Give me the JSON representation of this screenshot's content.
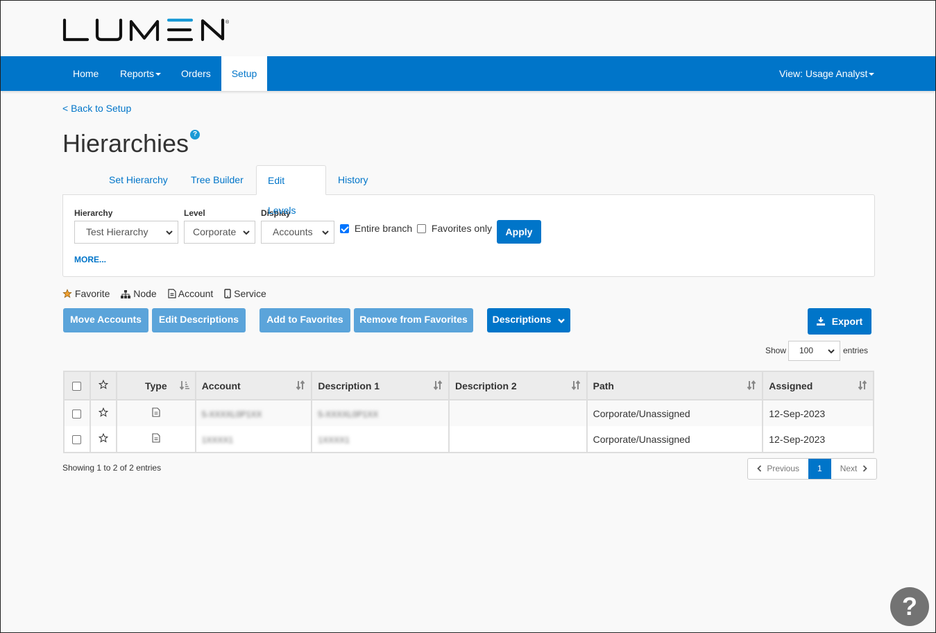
{
  "brand": {
    "logo_text": "LUMEN",
    "registered": "®",
    "accent": "#0075c9",
    "logo_accent": "#1a9ad6"
  },
  "nav": {
    "items": [
      {
        "label": "Home",
        "dropdown": false,
        "active": false
      },
      {
        "label": "Reports",
        "dropdown": true,
        "active": false
      },
      {
        "label": "Orders",
        "dropdown": false,
        "active": false
      },
      {
        "label": "Setup",
        "dropdown": false,
        "active": true
      }
    ],
    "view_label": "View: Usage Analyst"
  },
  "breadcrumb": {
    "back_label": "< Back to Setup"
  },
  "page": {
    "title": "Hierarchies",
    "help_glyph": "?"
  },
  "tabs": [
    {
      "label": "Set Hierarchy",
      "active": false
    },
    {
      "label": "Tree Builder",
      "active": false
    },
    {
      "label": "Edit Levels",
      "active": true
    },
    {
      "label": "History",
      "active": false
    }
  ],
  "filters": {
    "hierarchy": {
      "label": "Hierarchy",
      "value": "Test Hierarchy"
    },
    "level": {
      "label": "Level",
      "value": "Corporate"
    },
    "display": {
      "label": "Display",
      "value": "Accounts"
    },
    "entire_branch": {
      "label": "Entire branch",
      "checked": true
    },
    "favorites_only": {
      "label": "Favorites only",
      "checked": false
    },
    "apply_label": "Apply",
    "more_label": "MORE..."
  },
  "legend": {
    "favorite": "Favorite",
    "node": "Node",
    "account": "Account",
    "service": "Service"
  },
  "actions": {
    "move_accounts": "Move Accounts",
    "edit_descriptions": "Edit Descriptions",
    "add_favorites": "Add to Favorites",
    "remove_favorites": "Remove from Favorites",
    "descriptions": "Descriptions",
    "export": "Export"
  },
  "page_size": {
    "show_label": "Show",
    "value": "100",
    "entries_label": "entries"
  },
  "table": {
    "columns": [
      "",
      "",
      "Type",
      "Account",
      "Description 1",
      "Description 2",
      "Path",
      "Assigned"
    ],
    "rows": [
      {
        "checked": false,
        "favorite": false,
        "type": "account",
        "account": "5-XXXXL0P1XX",
        "description1": "5-XXXXL0P1XX",
        "description2": "",
        "path": "Corporate/Unassigned",
        "assigned": "12-Sep-2023"
      },
      {
        "checked": false,
        "favorite": false,
        "type": "account",
        "account": "1XXXX1",
        "description1": "1XXXX1",
        "description2": "",
        "path": "Corporate/Unassigned",
        "assigned": "12-Sep-2023"
      }
    ]
  },
  "footer": {
    "showing": "Showing 1 to 2 of 2 entries",
    "previous": "Previous",
    "current_page": "1",
    "next": "Next"
  },
  "help_fab": "?"
}
